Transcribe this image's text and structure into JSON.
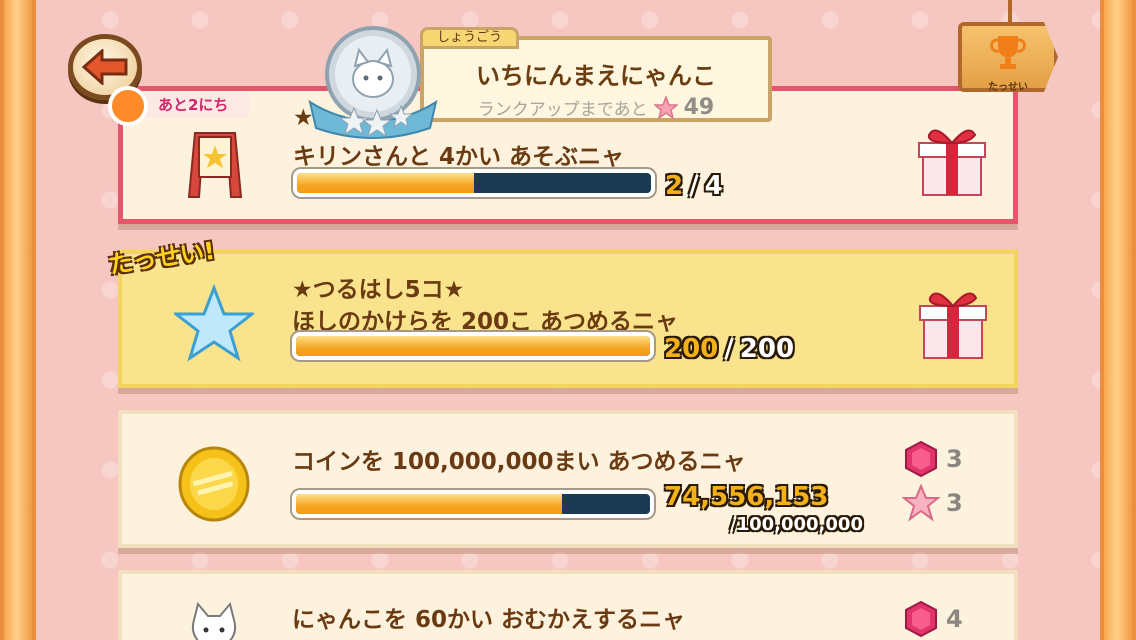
{
  "header": {
    "badge_caption": "しょうごう",
    "rank_title": "いちにんまえにゃんこ",
    "rank_up_label": "ランクアップまであと",
    "rank_up_remaining": "49",
    "days_left": "あと2にち",
    "achievements_label": "たっせい"
  },
  "missions": [
    {
      "title": "★",
      "description": "キリンさんと 4かい あそぶニャ",
      "current": "2",
      "separator": "/",
      "total": "4",
      "progress": 0.5,
      "highlight": "red",
      "icon": "signboard-icon",
      "reward": "gift-box-icon"
    },
    {
      "title": "★つるはし5コ★",
      "description": "ほしのかけらを 200こ あつめるニャ",
      "current": "200",
      "separator": "/",
      "total": "200",
      "progress": 1.0,
      "completed_label": "たっせい!",
      "icon": "star-icon",
      "reward": "gift-box-icon"
    },
    {
      "description": "コインを 100,000,000まい あつめるニャ",
      "current": "74,556,153",
      "total_line": "/100,000,000",
      "progress": 0.75,
      "icon": "coin-icon",
      "rewards": [
        {
          "icon": "gem-icon",
          "amount": "3"
        },
        {
          "icon": "star-shard-icon",
          "amount": "3"
        }
      ]
    },
    {
      "description": "にゃんこを 60かい おむかえするニャ",
      "icon": "cat-icon",
      "rewards": [
        {
          "icon": "gem-icon",
          "amount": "4"
        }
      ]
    }
  ],
  "colors": {
    "background": "#f6c7c0",
    "card": "#fdf2dd",
    "completed_card": "#f9e38c",
    "highlight_border": "#e8556a",
    "bar_fill": "#f5a524",
    "bar_empty": "#1c3a52",
    "text": "#6a3a12"
  }
}
